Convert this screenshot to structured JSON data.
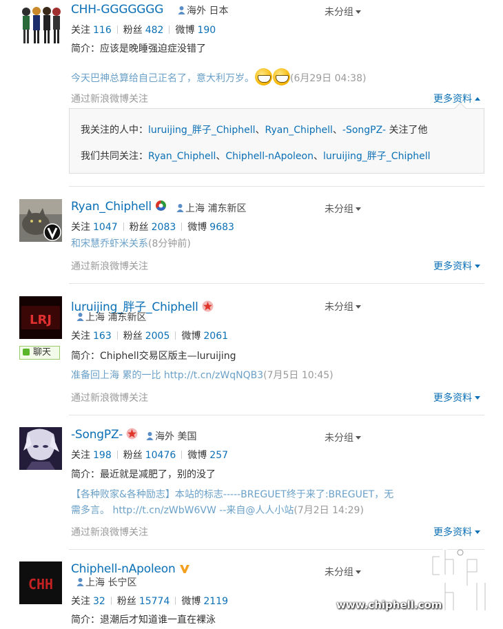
{
  "users": [
    {
      "nick": "CHH-GGGGGGG",
      "location": "海外 日本",
      "group": "未分组",
      "follow_label": "关注",
      "follow": "116",
      "fans_label": "粉丝",
      "fans": "482",
      "weibo_label": "微博",
      "weibo": "190",
      "bio": "简介：应该是晚睡强迫症没错了",
      "post_text": "今天巴神总算给自己正名了，意大利万岁。",
      "post_time": "(6月29日 04:38)",
      "via": "通过新浪微博关注",
      "more": "更多资料",
      "panel_line1_prefix": "我关注的人中：",
      "panel_line1_links": [
        "luruijing_胖子_Chiphell",
        "Ryan_Chiphell",
        "-SongPZ-"
      ],
      "panel_line1_suffix": " 关注了他",
      "panel_line2_prefix": "我们共同关注：",
      "panel_line2_links": [
        "Ryan_Chiphell",
        "Chiphell-nApoleon",
        "luruijing_胖子_Chiphell"
      ]
    },
    {
      "nick": "Ryan_Chiphell",
      "location": "上海 浦东新区",
      "group": "未分组",
      "follow_label": "关注",
      "follow": "1047",
      "fans_label": "粉丝",
      "fans": "2083",
      "weibo_label": "微博",
      "weibo": "9683",
      "post_text": "和宋慧乔虾米关系",
      "post_time": "(8分钟前)",
      "via": "通过新浪微博关注",
      "more": "更多资料"
    },
    {
      "nick": "luruijing_胖子_Chiphell",
      "location": "上海 浦东新区",
      "group": "未分组",
      "follow_label": "关注",
      "follow": "163",
      "fans_label": "粉丝",
      "fans": "2005",
      "weibo_label": "微博",
      "weibo": "2061",
      "chat": "聊天",
      "bio": "简介：Chiphell交易区版主—luruijing",
      "post_text": "准备回上海 累的一比 http://t.cn/zWqNQB3",
      "post_time": "(7月5日 10:45)",
      "via": "通过新浪微博关注",
      "more": "更多资料",
      "avatar_text": "LRJ"
    },
    {
      "nick": "-SongPZ-",
      "location": "海外 美国",
      "group": "未分组",
      "follow_label": "关注",
      "follow": "198",
      "fans_label": "粉丝",
      "fans": "10476",
      "weibo_label": "微博",
      "weibo": "257",
      "bio": "简介：最近就是减肥了，别的没了",
      "post_line1": "【各种败家&各种励志】本站的标志-----BREGUET终于来了:BREGUET，无",
      "post_line2": "需多言。 http://t.cn/zWbW6VW --来自@人人小站",
      "post_time": "(7月2日 14:29)",
      "via": "通过新浪微博关注",
      "more": "更多资料"
    },
    {
      "nick": "Chiphell-nApoleon",
      "location": "上海 长宁区",
      "group": "未分组",
      "follow_label": "关注",
      "follow": "32",
      "fans_label": "粉丝",
      "fans": "15774",
      "weibo_label": "微博",
      "weibo": "2119",
      "bio": "简介：退潮后才知道谁一直在裸泳",
      "avatar_text": "CHH"
    }
  ],
  "watermark": {
    "site": "www.chiphell.com",
    "logo_text": "chip hell"
  },
  "colors": {
    "link": "#0a6fb5",
    "post": "#6aa0c8",
    "muted": "#999999"
  }
}
